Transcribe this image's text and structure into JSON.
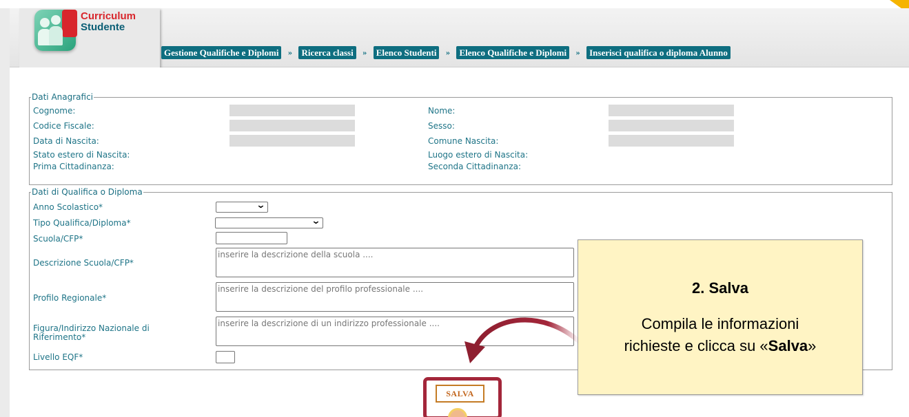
{
  "app": {
    "title_line1": "Curriculum",
    "title_line2": "Studente"
  },
  "breadcrumb": [
    "Gestione Qualifiche e Diplomi",
    "Ricerca classi",
    "Elenco Studenti",
    "Elenco Qualifiche e Diplomi",
    "Inserisci qualifica o diploma Alunno"
  ],
  "breadcrumb_separator": "»",
  "anagrafici": {
    "legend": "Dati Anagrafici",
    "cognome": "Cognome:",
    "codice_fiscale": "Codice Fiscale:",
    "data_nascita": "Data di Nascita:",
    "stato_estero": "Stato estero di Nascita:",
    "prima_cittadinanza": "Prima Cittadinanza:",
    "nome": "Nome:",
    "sesso": "Sesso:",
    "comune_nascita": "Comune Nascita:",
    "luogo_estero": "Luogo estero di Nascita:",
    "seconda_cittadinanza": "Seconda Cittadinanza:"
  },
  "qualifica": {
    "legend": "Dati di Qualifica o Diploma",
    "anno_scolastico": "Anno Scolastico*",
    "tipo_qualifica": "Tipo Qualifica/Diploma*",
    "scuola_cfp": "Scuola/CFP*",
    "descrizione_scuola": "Descrizione Scuola/CFP*",
    "descrizione_scuola_placeholder": "inserire la descrizione della scuola ....",
    "profilo_regionale": "Profilo Regionale*",
    "profilo_placeholder": "inserire la descrizione del profilo professionale ....",
    "figura_line1": "Figura/Indirizzo Nazionale di",
    "figura_line2": "Riferimento*",
    "figura_placeholder": "inserire la descrizione di un indirizzo professionale ....",
    "livello_eqf": "Livello EQF*"
  },
  "callout": {
    "title": "2. Salva",
    "line1": "Compila le informazioni",
    "line2_prefix": "richieste e clicca su «",
    "line2_bold": "Salva",
    "line2_suffix": "»"
  },
  "save_button": "SALVA",
  "colors": {
    "accent": "#0e6e80",
    "label": "#1e7487",
    "highlight": "#a3263a",
    "callout_bg": "#fff4c4"
  }
}
